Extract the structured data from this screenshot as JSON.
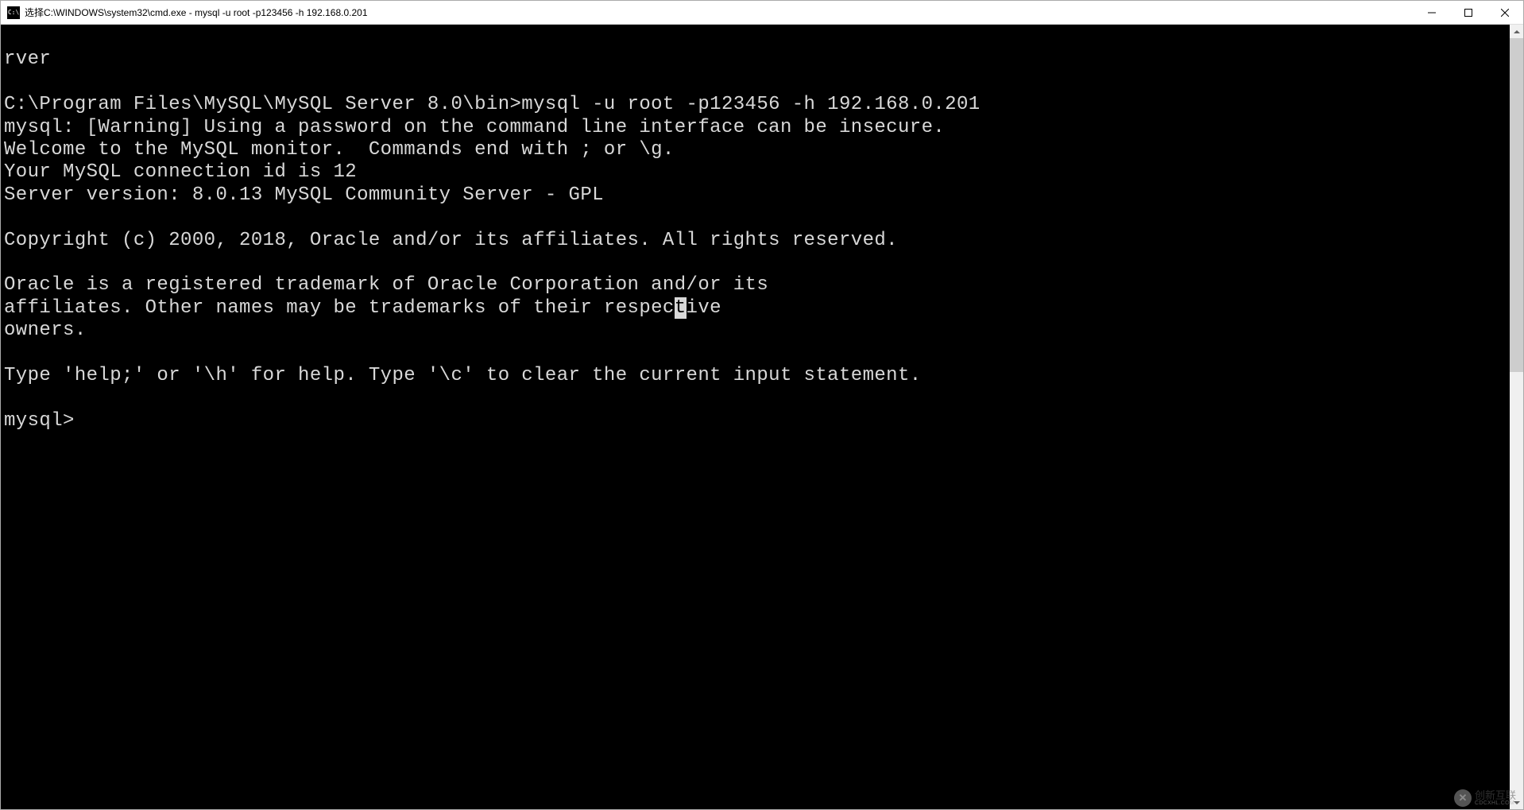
{
  "titlebar": {
    "icon_text": "C:\\",
    "title": "选择C:\\WINDOWS\\system32\\cmd.exe - mysql  -u root -p123456 -h 192.168.0.201"
  },
  "terminal": {
    "lines": [
      "rver",
      "",
      "C:\\Program Files\\MySQL\\MySQL Server 8.0\\bin>mysql -u root -p123456 -h 192.168.0.201",
      "mysql: [Warning] Using a password on the command line interface can be insecure.",
      "Welcome to the MySQL monitor.  Commands end with ; or \\g.",
      "Your MySQL connection id is 12",
      "Server version: 8.0.13 MySQL Community Server - GPL",
      "",
      "Copyright (c) 2000, 2018, Oracle and/or its affiliates. All rights reserved.",
      "",
      "Oracle is a registered trademark of Oracle Corporation and/or its"
    ],
    "cursor_line_pre": "affiliates. Other names may be trademarks of their respec",
    "cursor_char": "t",
    "cursor_line_post": "ive",
    "lines_after": [
      "owners.",
      "",
      "Type 'help;' or '\\h' for help. Type '\\c' to clear the current input statement.",
      "",
      "mysql>"
    ]
  },
  "watermark": {
    "icon_char": "✕",
    "main": "创新互联",
    "sub": "CDCXHL.COM"
  }
}
